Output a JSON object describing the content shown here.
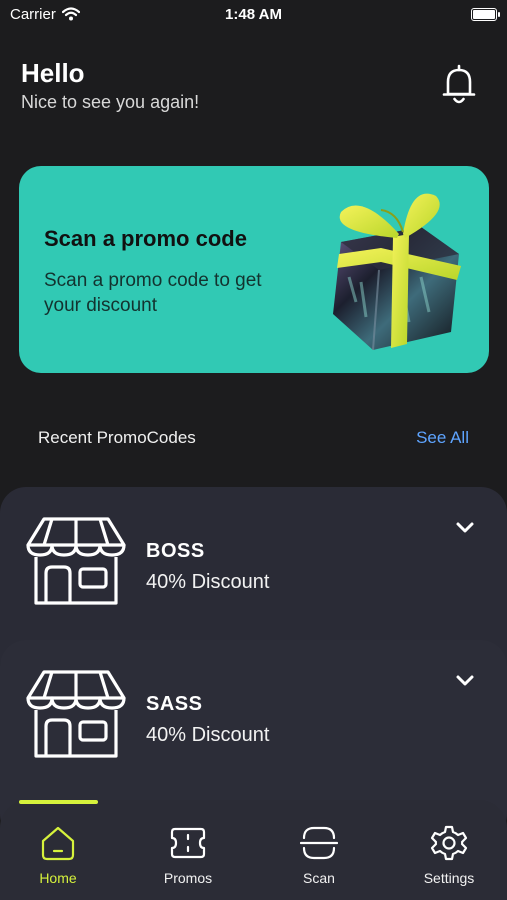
{
  "status_bar": {
    "carrier": "Carrier",
    "time": "1:48 AM",
    "battery_level": 1.0
  },
  "header": {
    "title": "Hello",
    "subtitle": "Nice to see you again!"
  },
  "promo_banner": {
    "title": "Scan a promo code",
    "description": "Scan a promo code to get your discount",
    "color": "#31c9b4"
  },
  "recent": {
    "title": "Recent PromoCodes",
    "see_all_label": "See All"
  },
  "promo_codes": [
    {
      "name": "BOSS",
      "discount": "40% Discount",
      "icon": "store-icon"
    },
    {
      "name": "SASS",
      "discount": "40% Discount",
      "icon": "store-icon"
    }
  ],
  "tab_bar": {
    "active_color": "#d6f23c",
    "tabs": [
      {
        "label": "Home",
        "icon": "home-icon",
        "active": true
      },
      {
        "label": "Promos",
        "icon": "ticket-icon",
        "active": false
      },
      {
        "label": "Scan",
        "icon": "scan-icon",
        "active": false
      },
      {
        "label": "Settings",
        "icon": "gear-icon",
        "active": false
      }
    ]
  }
}
